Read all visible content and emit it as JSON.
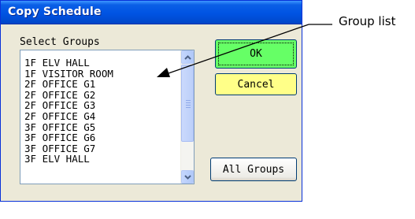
{
  "window": {
    "title": "Copy Schedule"
  },
  "group_section": {
    "label": "Select Groups"
  },
  "group_list": {
    "items": [
      "1F ELV HALL",
      "1F VISITOR ROOM",
      "2F OFFICE G1",
      "2F OFFICE G2",
      "2F OFFICE G3",
      "2F OFFICE G4",
      "3F OFFICE G5",
      "3F OFFICE G6",
      "3F OFFICE G7",
      "3F ELV HALL"
    ]
  },
  "buttons": {
    "ok": "OK",
    "cancel": "Cancel",
    "all_groups": "All Groups"
  },
  "annotation": {
    "label": "Group list"
  },
  "colors": {
    "ok_button": "#66ff66",
    "cancel_button": "#ffff88",
    "titlebar": "#0054e3"
  }
}
